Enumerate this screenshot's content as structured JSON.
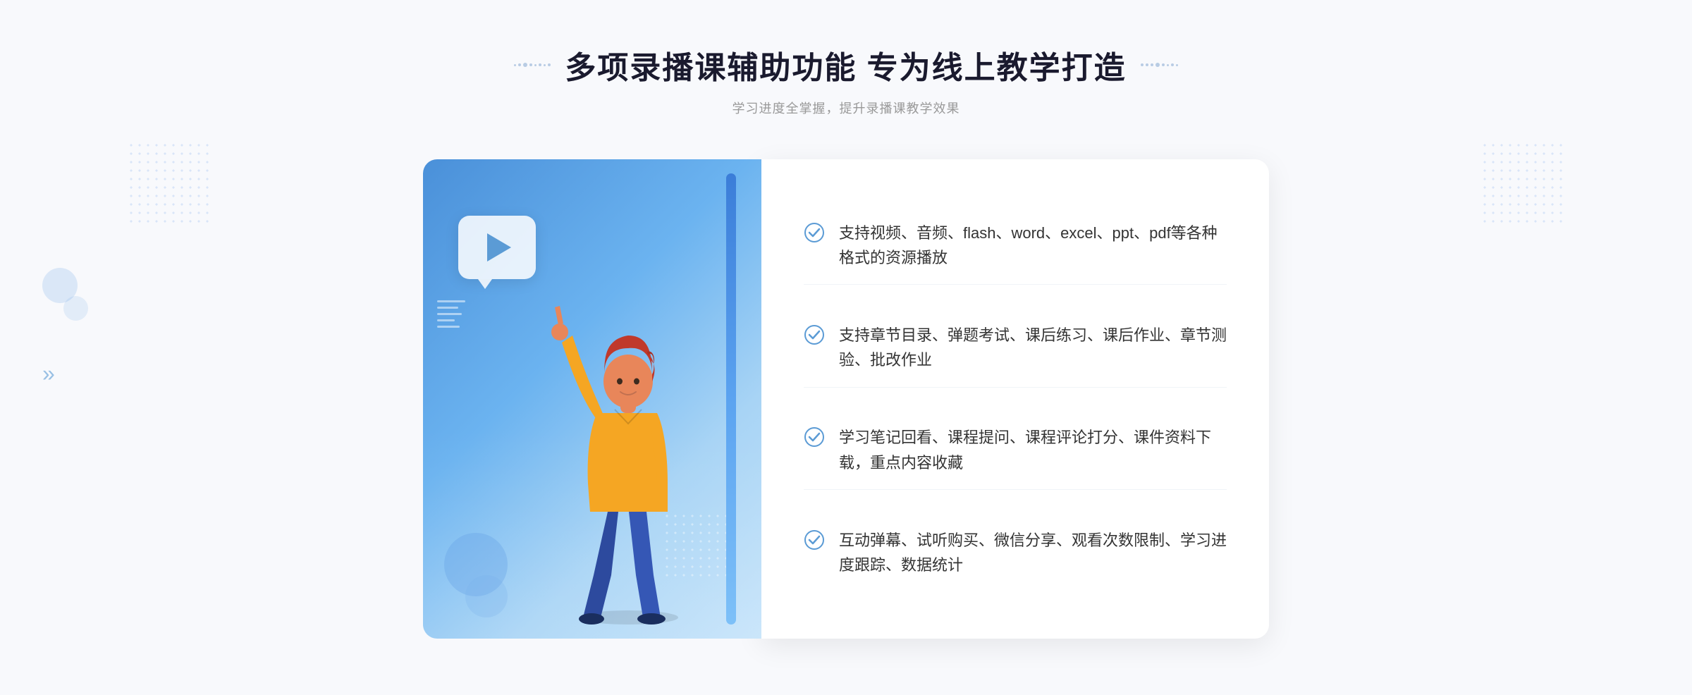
{
  "page": {
    "background_color": "#f8f9fc"
  },
  "header": {
    "title": "多项录播课辅助功能 专为线上教学打造",
    "subtitle": "学习进度全掌握，提升录播课教学效果"
  },
  "features": [
    {
      "id": "feature-1",
      "text": "支持视频、音频、flash、word、excel、ppt、pdf等各种格式的资源播放"
    },
    {
      "id": "feature-2",
      "text": "支持章节目录、弹题考试、课后练习、课后作业、章节测验、批改作业"
    },
    {
      "id": "feature-3",
      "text": "学习笔记回看、课程提问、课程评论打分、课件资料下载，重点内容收藏"
    },
    {
      "id": "feature-4",
      "text": "互动弹幕、试听购买、微信分享、观看次数限制、学习进度跟踪、数据统计"
    }
  ],
  "icons": {
    "check": "check-circle-icon",
    "play": "play-icon",
    "arrow_left": "chevron-left-icon"
  },
  "colors": {
    "primary_blue": "#4a8fd4",
    "light_blue": "#6bb3f0",
    "text_dark": "#333333",
    "text_title": "#1a1a2e",
    "text_sub": "#999999",
    "white": "#ffffff",
    "check_color": "#5b9bd5"
  }
}
